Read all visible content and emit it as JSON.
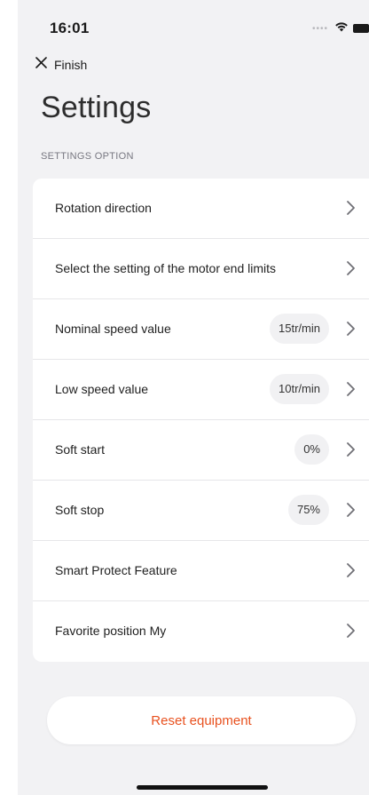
{
  "status_bar": {
    "time": "16:01",
    "signal_icon": "signal-dots-icon",
    "wifi_icon": "wifi-icon",
    "battery_icon": "battery-icon"
  },
  "nav": {
    "close_icon": "close-icon",
    "finish_label": "Finish"
  },
  "page": {
    "title": "Settings",
    "section_caption": "SETTINGS OPTION"
  },
  "settings": {
    "chevron_icon": "chevron-right-icon",
    "items": [
      {
        "label": "Rotation direction",
        "value": null
      },
      {
        "label": "Select the setting of the motor end limits",
        "value": null
      },
      {
        "label": "Nominal speed value",
        "value": "15tr/min"
      },
      {
        "label": "Low speed value",
        "value": "10tr/min"
      },
      {
        "label": "Soft start",
        "value": "0%"
      },
      {
        "label": "Soft stop",
        "value": "75%"
      },
      {
        "label": "Smart Protect Feature",
        "value": null
      },
      {
        "label": "Favorite position My",
        "value": null
      }
    ]
  },
  "reset": {
    "label": "Reset equipment"
  },
  "colors": {
    "background": "#f2f2f4",
    "card": "#ffffff",
    "accent": "#e8511f",
    "value_pill": "#f1f1f3",
    "chevron": "#6f6f75"
  }
}
